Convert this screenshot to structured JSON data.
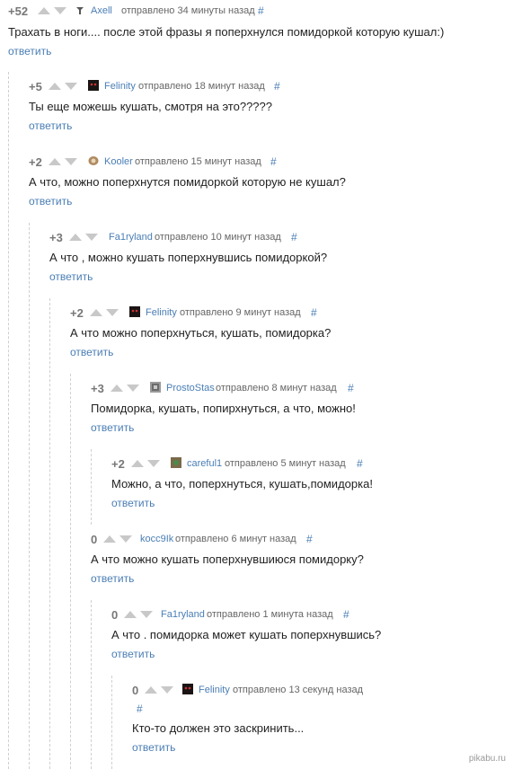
{
  "reply_label": "ответить",
  "comments": [
    {
      "score": "+52",
      "user": "Axell",
      "meta": "отправлено 34 минуты назад",
      "hash": "#",
      "text": "Трахать в ноги.... после этой фразы я поперхнулся помидоркой которую кушал:)"
    },
    {
      "score": "+5",
      "user": "Felinity",
      "meta": "отправлено 18 минут назад",
      "hash": "#",
      "text": "Ты еще можешь кушать, смотря на это?????"
    },
    {
      "score": "+2",
      "user": "Kooler",
      "meta": "отправлено 15 минут назад",
      "hash": "#",
      "text": "А что, можно поперхнутся помидоркой которую не кушал?"
    },
    {
      "score": "+3",
      "user": "Fa1ryland",
      "meta": "отправлено 10 минут назад",
      "hash": "#",
      "text": "А что , можно кушать поперхнувшись помидоркой?"
    },
    {
      "score": "+2",
      "user": "Felinity",
      "meta": "отправлено 9 минут назад",
      "hash": "#",
      "text": "А что можно поперхнуться, кушать, помидорка?"
    },
    {
      "score": "+3",
      "user": "ProstoStas",
      "meta": "отправлено 8 минут назад",
      "hash": "#",
      "text": "Помидорка, кушать, попирхнуться, а что, можно!"
    },
    {
      "score": "+2",
      "user": "careful1",
      "meta": "отправлено 5 минут назад",
      "hash": "#",
      "text": "Можно, а что, поперхнуться, кушать,помидорка!"
    },
    {
      "score": "0",
      "user": "kocc9Ik",
      "meta": "отправлено 6 минут назад",
      "hash": "#",
      "text": "А что можно кушать поперхнувшиюся помидорку?"
    },
    {
      "score": "0",
      "user": "Fa1ryland",
      "meta": "отправлено 1 минута назад",
      "hash": "#",
      "text": "А что . помидорка может кушать поперхнувшись?"
    },
    {
      "score": "0",
      "user": "Felinity",
      "meta": "отправлено 13 секунд назад",
      "hash": "#",
      "text": "Кто-то должен это заскринить..."
    }
  ],
  "watermark": "pikabu.ru"
}
